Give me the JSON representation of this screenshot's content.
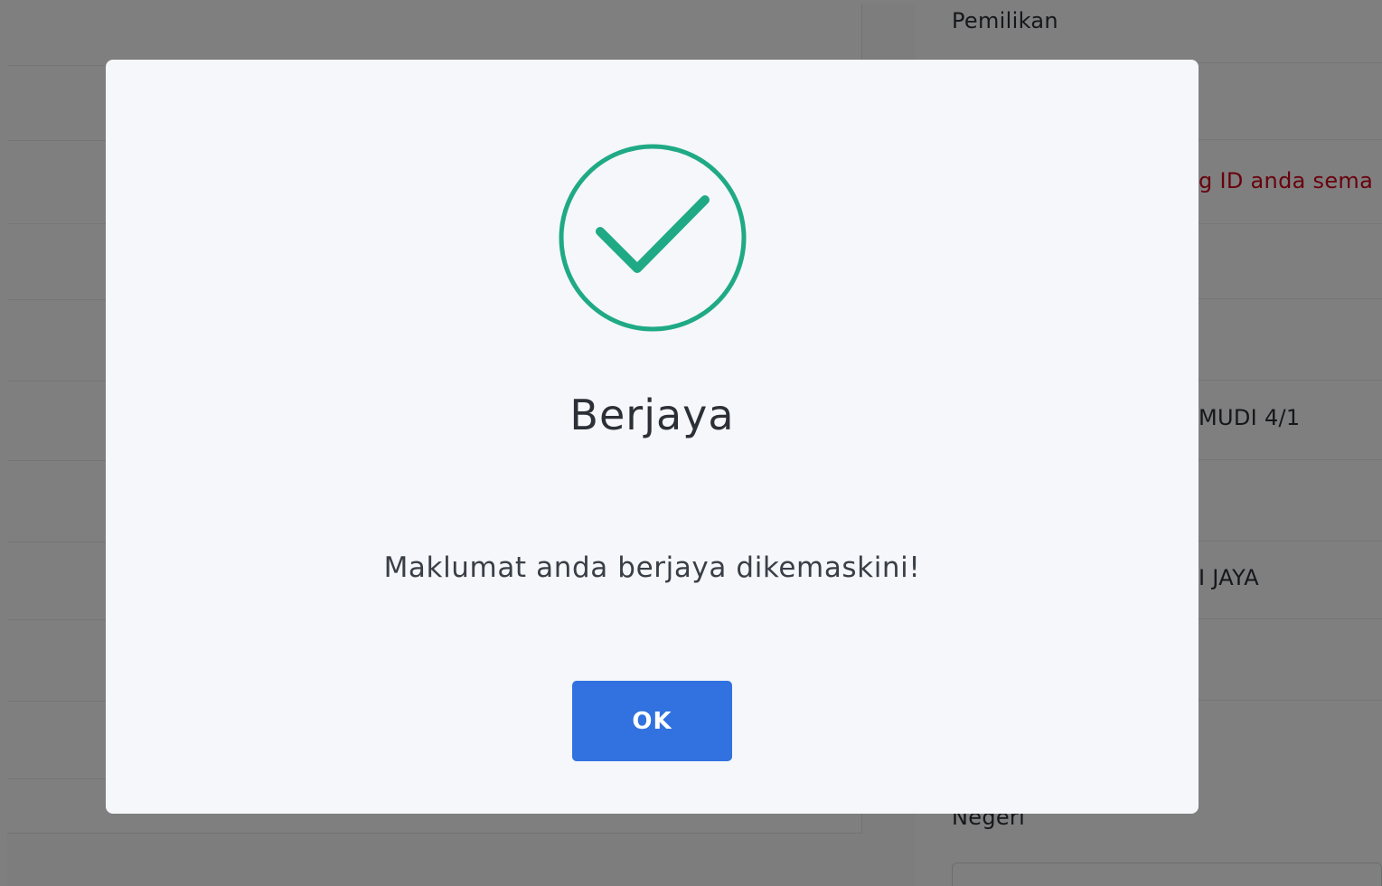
{
  "background": {
    "labels": {
      "pemilikan": "Pemilikan",
      "warning_fragment": "g ID anda sema",
      "value_fragment_1": "MUDI 4/1",
      "value_fragment_2": "I JAYA",
      "negeri": "Negeri"
    },
    "warning_color": "#d0021b"
  },
  "dialog": {
    "icon": "check-circle-icon",
    "icon_color": "#1faa85",
    "title": "Berjaya",
    "message": "Maklumat anda berjaya dikemaskini!",
    "ok_label": "OK",
    "ok_color": "#3172e0"
  }
}
